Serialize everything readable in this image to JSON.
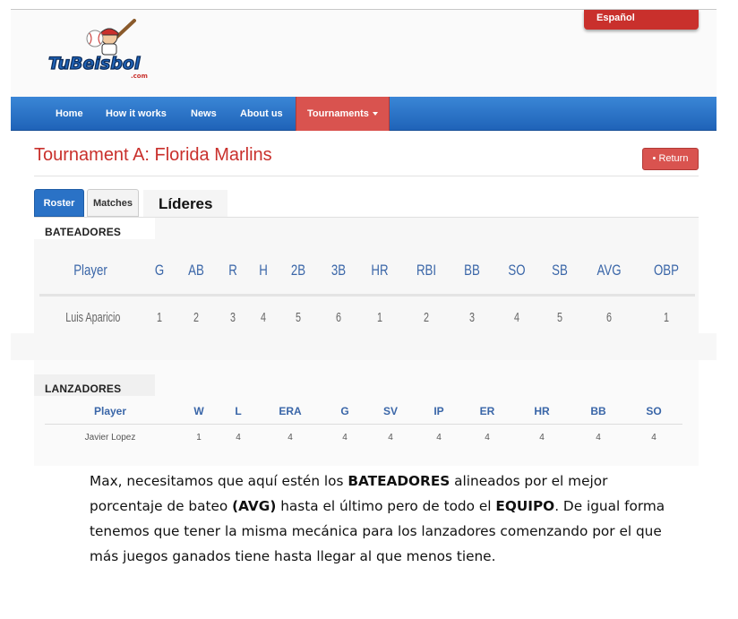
{
  "header": {
    "logo_text": "TuBeisbol",
    "logo_suffix": ".com",
    "language_button": "Español"
  },
  "nav": {
    "items": [
      {
        "label": "Home"
      },
      {
        "label": "How it works"
      },
      {
        "label": "News"
      },
      {
        "label": "About us"
      },
      {
        "label": "Tournaments"
      }
    ],
    "active_index": 4
  },
  "page": {
    "title": "Tournament A: Florida Marlins",
    "return_button": "Return",
    "return_icon": "bullet-icon"
  },
  "tabs": [
    {
      "label": "Roster",
      "active": true
    },
    {
      "label": "Matches",
      "active": false
    }
  ],
  "leaders_label": "Líderes",
  "batting": {
    "label": "BATEADORES",
    "headers": [
      "Player",
      "G",
      "AB",
      "R",
      "H",
      "2B",
      "3B",
      "HR",
      "RBI",
      "BB",
      "SO",
      "SB",
      "AVG",
      "OBP"
    ],
    "rows": [
      [
        "Luis Aparicio",
        "1",
        "2",
        "3",
        "4",
        "5",
        "6",
        "1",
        "2",
        "3",
        "4",
        "5",
        "6",
        "1"
      ]
    ]
  },
  "pitching": {
    "label": "LANZADORES",
    "headers": [
      "Player",
      "W",
      "L",
      "ERA",
      "G",
      "SV",
      "IP",
      "ER",
      "HR",
      "BB",
      "SO"
    ],
    "rows": [
      [
        "Javier Lopez",
        "1",
        "4",
        "4",
        "4",
        "4",
        "4",
        "4",
        "4",
        "4",
        "4"
      ]
    ]
  },
  "note": {
    "p1": "Max,  necesitamos que aquí estén los ",
    "b1": "BATEADORES",
    "p2": " alineados por el mejor porcentaje de bateo ",
    "b2": "(AVG)",
    "p3": " hasta el último pero de todo el ",
    "b3": "EQUIPO",
    "p4": ".  De igual forma tenemos que tener la misma mecánica para los lanzadores comenzando por el que más juegos ganados tiene hasta llegar al que menos tiene."
  },
  "colors": {
    "brand_red": "#c9302c",
    "nav_blue": "#2a72c6",
    "header_blue": "#3a66a8"
  }
}
